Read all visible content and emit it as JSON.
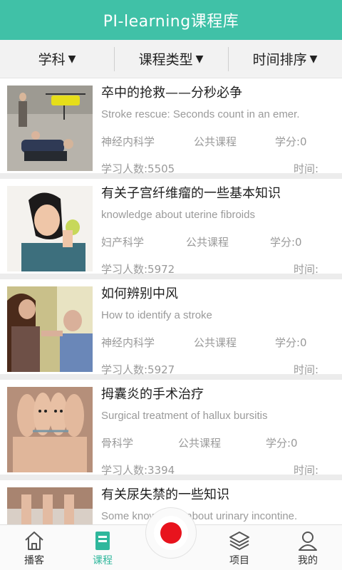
{
  "header": {
    "title": "PI-learning课程库"
  },
  "filters": [
    {
      "label": "学科",
      "arrow": "▼"
    },
    {
      "label": "课程类型",
      "arrow": "▼"
    },
    {
      "label": "时间排序",
      "arrow": "▼"
    }
  ],
  "courses": [
    {
      "title": "卒中的抢救——分秒必争",
      "subtitle": "Stroke rescue: Seconds count in an emer.",
      "department": "神经内科学",
      "type": "公共课程",
      "credits": "学分:0",
      "learners": "学习人数:5505",
      "time": "时间:"
    },
    {
      "title": "有关子宫纤维瘤的一些基本知识",
      "subtitle": "knowledge about uterine fibroids",
      "department": "妇产科学",
      "type": "公共课程",
      "credits": "学分:0",
      "learners": "学习人数:5972",
      "time": "时间:"
    },
    {
      "title": "如何辨别中风",
      "subtitle": "How to identify a stroke",
      "department": "神经内科学",
      "type": "公共课程",
      "credits": "学分:0",
      "learners": "学习人数:5927",
      "time": "时间:"
    },
    {
      "title": "拇囊炎的手术治疗",
      "subtitle": "Surgical treatment of hallux bursitis",
      "department": "骨科学",
      "type": "公共课程",
      "credits": "学分:0",
      "learners": "学习人数:3394",
      "time": "时间:"
    },
    {
      "title": "有关尿失禁的一些知识",
      "subtitle": "Some knowledge about urinary incontine.",
      "department": "",
      "type": "",
      "credits": "",
      "learners": "",
      "time": ""
    }
  ],
  "tabs": [
    {
      "label": "播客",
      "icon": "home-icon"
    },
    {
      "label": "课程",
      "icon": "course-icon",
      "active": true
    },
    {
      "label": "",
      "icon": "record-icon"
    },
    {
      "label": "项目",
      "icon": "layers-icon"
    },
    {
      "label": "我的",
      "icon": "profile-icon"
    }
  ],
  "colors": {
    "accent": "#40c1a7",
    "record": "#e8131d",
    "active_tab": "#2fb79c"
  }
}
